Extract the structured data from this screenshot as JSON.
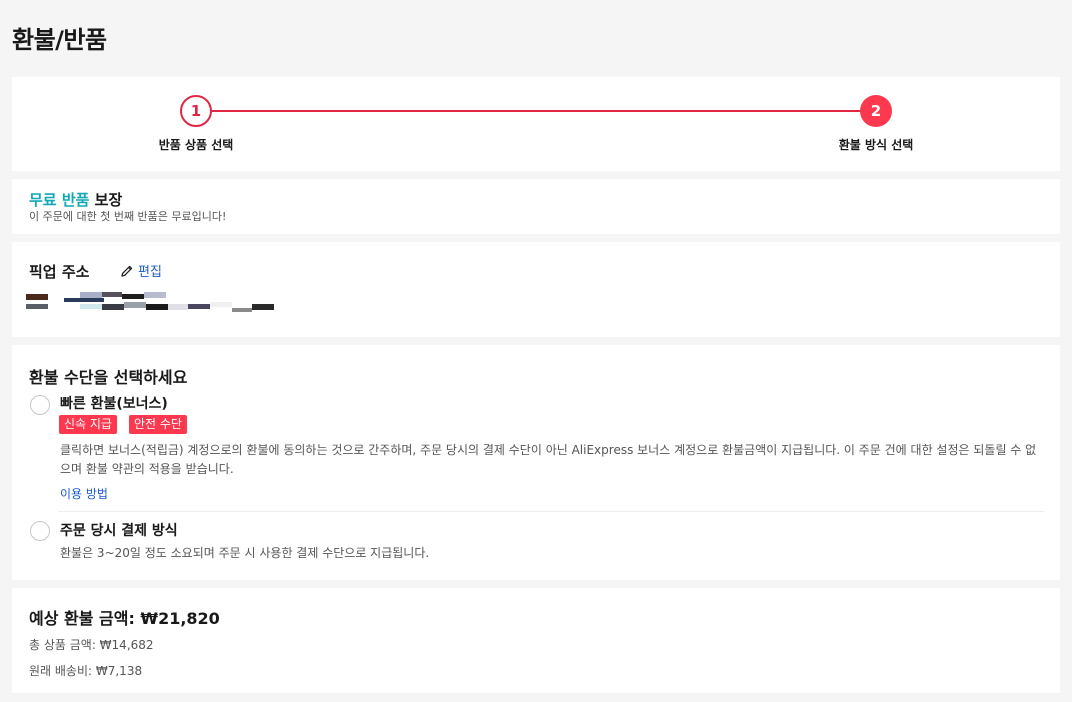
{
  "page": {
    "title": "환불/반품"
  },
  "stepper": {
    "steps": [
      {
        "number": "1",
        "label": "반품 상품 선택"
      },
      {
        "number": "2",
        "label": "환불 방식 선택"
      }
    ]
  },
  "free_return": {
    "title_accent": "무료 반품",
    "title_rest": "보장",
    "subtitle": "이 주문에 대한 첫 번째 반품은 무료입니다!"
  },
  "pickup": {
    "title": "픽업 주소",
    "edit_label": "편집"
  },
  "refund_method": {
    "title": "환불 수단을 선택하세요",
    "options": [
      {
        "title": "빠른 환불(보너스)",
        "tags": [
          "신속 지급",
          "안전 수단"
        ],
        "description": "클릭하면 보너스(적립금) 계정으로의 환불에 동의하는 것으로 간주하며, 주문 당시의 결제 수단이 아닌 AliExpress 보너스 계정으로 환불금액이 지급됩니다. 이 주문 건에 대한 설정은 되돌릴 수 없으며 환불 약관의 적용을 받습니다.",
        "link": "이용 방법"
      },
      {
        "title": "주문 당시 결제 방식",
        "description": "환불은 3~20일 정도 소요되며 주문 시 사용한 결제 수단으로 지급됩니다."
      }
    ]
  },
  "summary": {
    "title": "예상 환불 금액: ₩21,820",
    "items_total": "총 상품 금액: ₩14,682",
    "shipping": "원래 배송비: ₩7,138"
  },
  "colors": {
    "accent_red": "#fd384f",
    "accent_teal": "#13a8b7",
    "link_blue": "#1d5bd6"
  }
}
